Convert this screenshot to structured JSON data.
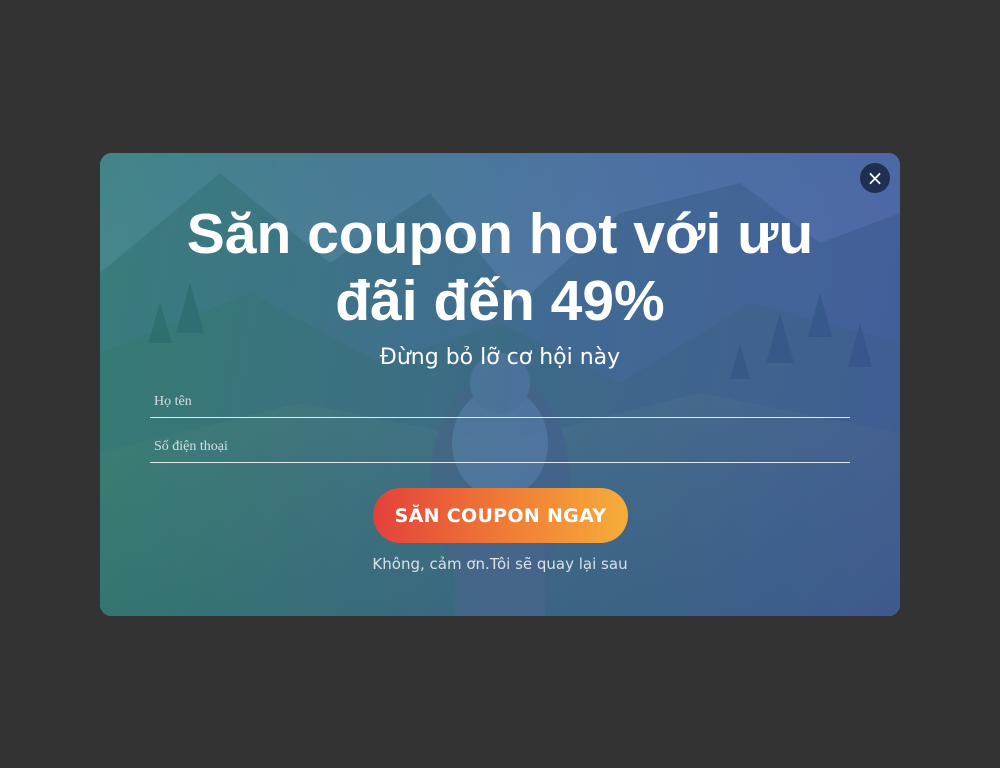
{
  "popup": {
    "close_symbol": "×",
    "headline": "Săn coupon hot với ưu đãi đến 49%",
    "subheadline": "Đừng bỏ lỡ cơ hội này",
    "form": {
      "name_placeholder": "Họ tên",
      "phone_placeholder": "Số điện thoại"
    },
    "cta_label": "SĂN COUPON NGAY",
    "dismiss_label": "Không, cảm ơn.Tôi sẽ quay lại sau"
  },
  "colors": {
    "backdrop": "#333333",
    "cta_start": "#e2413a",
    "cta_end": "#f6ad3a",
    "close_button": "#1e2f52"
  }
}
